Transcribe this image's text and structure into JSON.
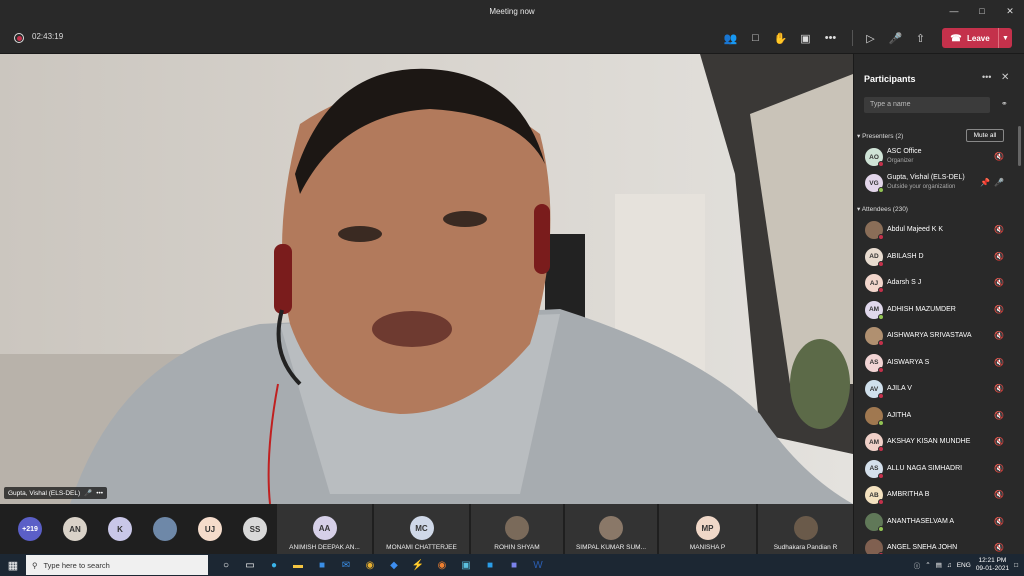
{
  "window": {
    "title": "Meeting now"
  },
  "toolbar": {
    "timer": "02:43:19",
    "leave_label": "Leave"
  },
  "video": {
    "speaker_name": "Gupta, Vishal (ELS-DEL)"
  },
  "gallery": {
    "overflow_count": "+219",
    "small_avatars": [
      {
        "initials": "AN",
        "color": "#d9d2c8"
      },
      {
        "initials": "K",
        "color": "#c9c7e8"
      },
      {
        "initials": "",
        "color": "#6e88a8"
      },
      {
        "initials": "UJ",
        "color": "#f5dccb"
      },
      {
        "initials": "SS",
        "color": "#d8d8d8"
      }
    ],
    "tiles": [
      {
        "initials": "AA",
        "name": "ANIMISH DEEPAK AN...",
        "color": "#d6d0e8"
      },
      {
        "initials": "MC",
        "name": "MONAMI CHATTERJEE",
        "color": "#cfd8e8"
      },
      {
        "initials": "",
        "name": "ROHIN SHYAM",
        "color": "#7a6a5a"
      },
      {
        "initials": "",
        "name": "SIMPAL KUMAR SUM...",
        "color": "#8a7868"
      },
      {
        "initials": "MP",
        "name": "MANISHA P",
        "color": "#f0d8c8"
      },
      {
        "initials": "",
        "name": "Sudhakara Pandian R",
        "color": "#6a5a4a"
      }
    ]
  },
  "participants": {
    "title": "Participants",
    "search_placeholder": "Type a name",
    "presenters_header": "Presenters (2)",
    "mute_all": "Mute all",
    "attendees_header": "Attendees (230)",
    "presenters": [
      {
        "initials": "AO",
        "name": "ASC Office",
        "sub": "Organizer",
        "color": "#cfe3d6"
      },
      {
        "initials": "VG",
        "name": "Gupta, Vishal (ELS-DEL)",
        "sub": "Outside your organization",
        "color": "#e3d6ea"
      }
    ],
    "attendees": [
      {
        "initials": "",
        "name": "Abdul Majeed K K",
        "color": "#8a6e58"
      },
      {
        "initials": "AD",
        "name": "ABILASH D",
        "color": "#e8dcd0"
      },
      {
        "initials": "AJ",
        "name": "Adarsh S J",
        "color": "#f2d6cc"
      },
      {
        "initials": "AM",
        "name": "ADHISH MAZUMDER",
        "color": "#e0d8ec"
      },
      {
        "initials": "",
        "name": "AISHWARYA SRIVASTAVA",
        "color": "#b09070"
      },
      {
        "initials": "AS",
        "name": "AISWARYA S",
        "color": "#f2d4d4"
      },
      {
        "initials": "AV",
        "name": "AJILA V",
        "color": "#d0e0ec"
      },
      {
        "initials": "",
        "name": "AJITHA",
        "color": "#a07850"
      },
      {
        "initials": "AM",
        "name": "AKSHAY KISAN MUNDHE",
        "color": "#f0d0c8"
      },
      {
        "initials": "AS",
        "name": "ALLU NAGA SIMHADRI",
        "color": "#d4e0ec"
      },
      {
        "initials": "AB",
        "name": "AMBRITHA B",
        "color": "#f4e2c0"
      },
      {
        "initials": "",
        "name": "ANANTHASELVAM A",
        "color": "#607858"
      },
      {
        "initials": "",
        "name": "ANGEL SNEHA JOHN",
        "color": "#806050"
      }
    ]
  },
  "taskbar": {
    "search_placeholder": "Type here to search",
    "lang": "ENG",
    "time": "12:21 PM",
    "date": "09-01-2021"
  }
}
